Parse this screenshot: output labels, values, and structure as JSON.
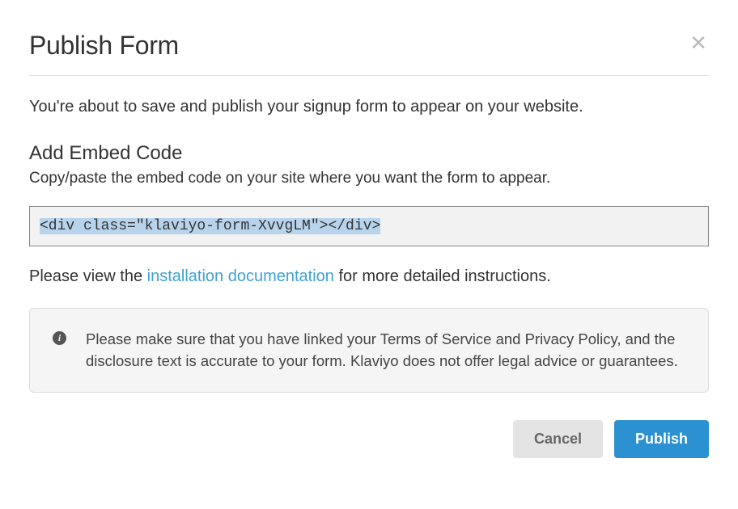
{
  "modal": {
    "title": "Publish Form",
    "intro": "You're about to save and publish your signup form to appear on your website.",
    "embed": {
      "heading": "Add Embed Code",
      "sub": "Copy/paste the embed code on your site where you want the form to appear.",
      "code": "<div class=\"klaviyo-form-XvvgLM\"></div>"
    },
    "docs": {
      "pre": "Please view the ",
      "link": "installation documentation",
      "post": " for more detailed instructions."
    },
    "notice": "Please make sure that you have linked your Terms of Service and Privacy Policy, and the disclosure text is accurate to your form. Klaviyo does not offer legal advice or guarantees.",
    "buttons": {
      "cancel": "Cancel",
      "publish": "Publish"
    }
  }
}
